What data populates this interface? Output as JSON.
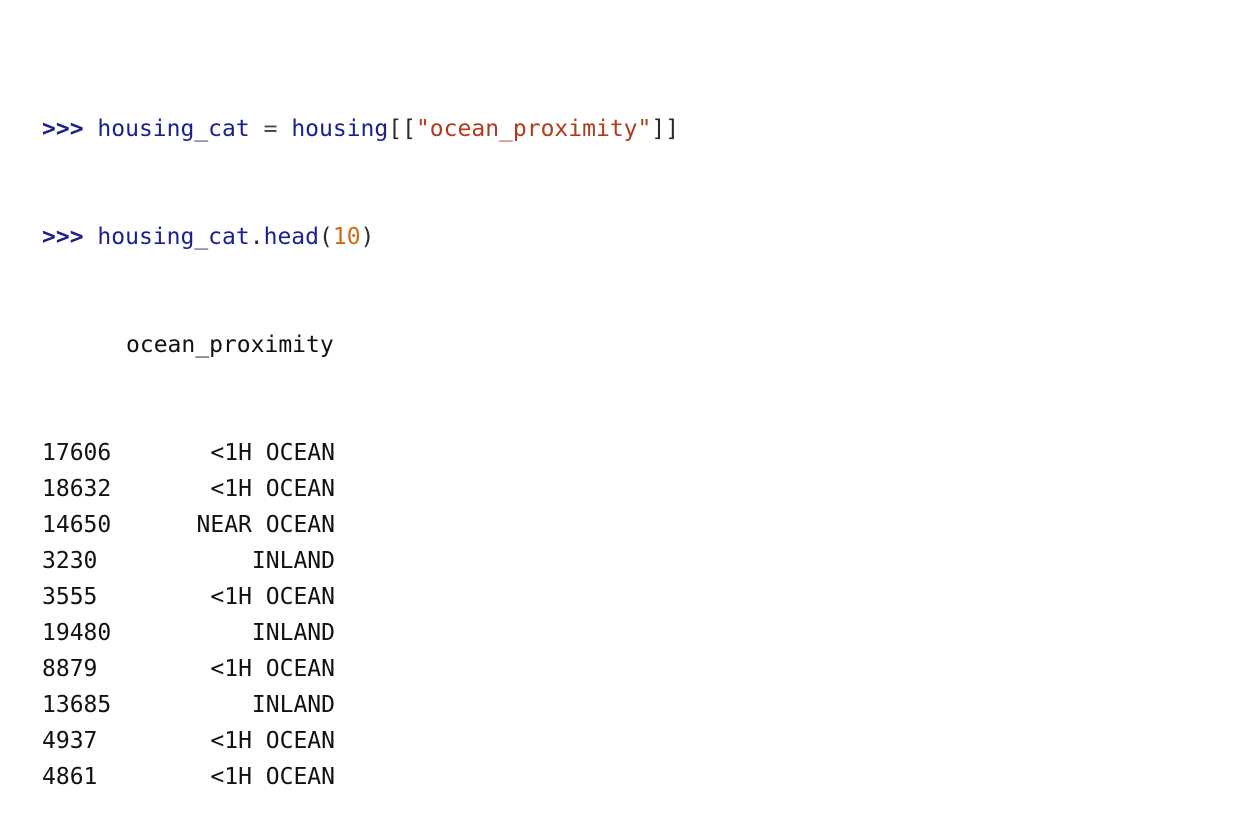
{
  "repl": {
    "line1": {
      "prompt": ">>>",
      "var": "housing_cat",
      "op": "=",
      "obj": "housing",
      "open": "[[",
      "string": "\"ocean_proximity\"",
      "close": "]]"
    },
    "line2": {
      "prompt": ">>>",
      "var": "housing_cat",
      "dot": ".",
      "method": "head",
      "open": "(",
      "arg": "10",
      "close": ")"
    }
  },
  "output": {
    "column_header": "ocean_proximity",
    "rows": [
      {
        "index": "17606",
        "value": "<1H OCEAN"
      },
      {
        "index": "18632",
        "value": "<1H OCEAN"
      },
      {
        "index": "14650",
        "value": "NEAR OCEAN"
      },
      {
        "index": "3230",
        "value": "INLAND"
      },
      {
        "index": "3555",
        "value": "<1H OCEAN"
      },
      {
        "index": "19480",
        "value": "INLAND"
      },
      {
        "index": "8879",
        "value": "<1H OCEAN"
      },
      {
        "index": "13685",
        "value": "INLAND"
      },
      {
        "index": "4937",
        "value": "<1H OCEAN"
      },
      {
        "index": "4861",
        "value": "<1H OCEAN"
      }
    ]
  },
  "colors": {
    "prompt": "#1b1f8f",
    "string": "#b23a1e",
    "number": "#d06b12",
    "text": "#111111"
  }
}
